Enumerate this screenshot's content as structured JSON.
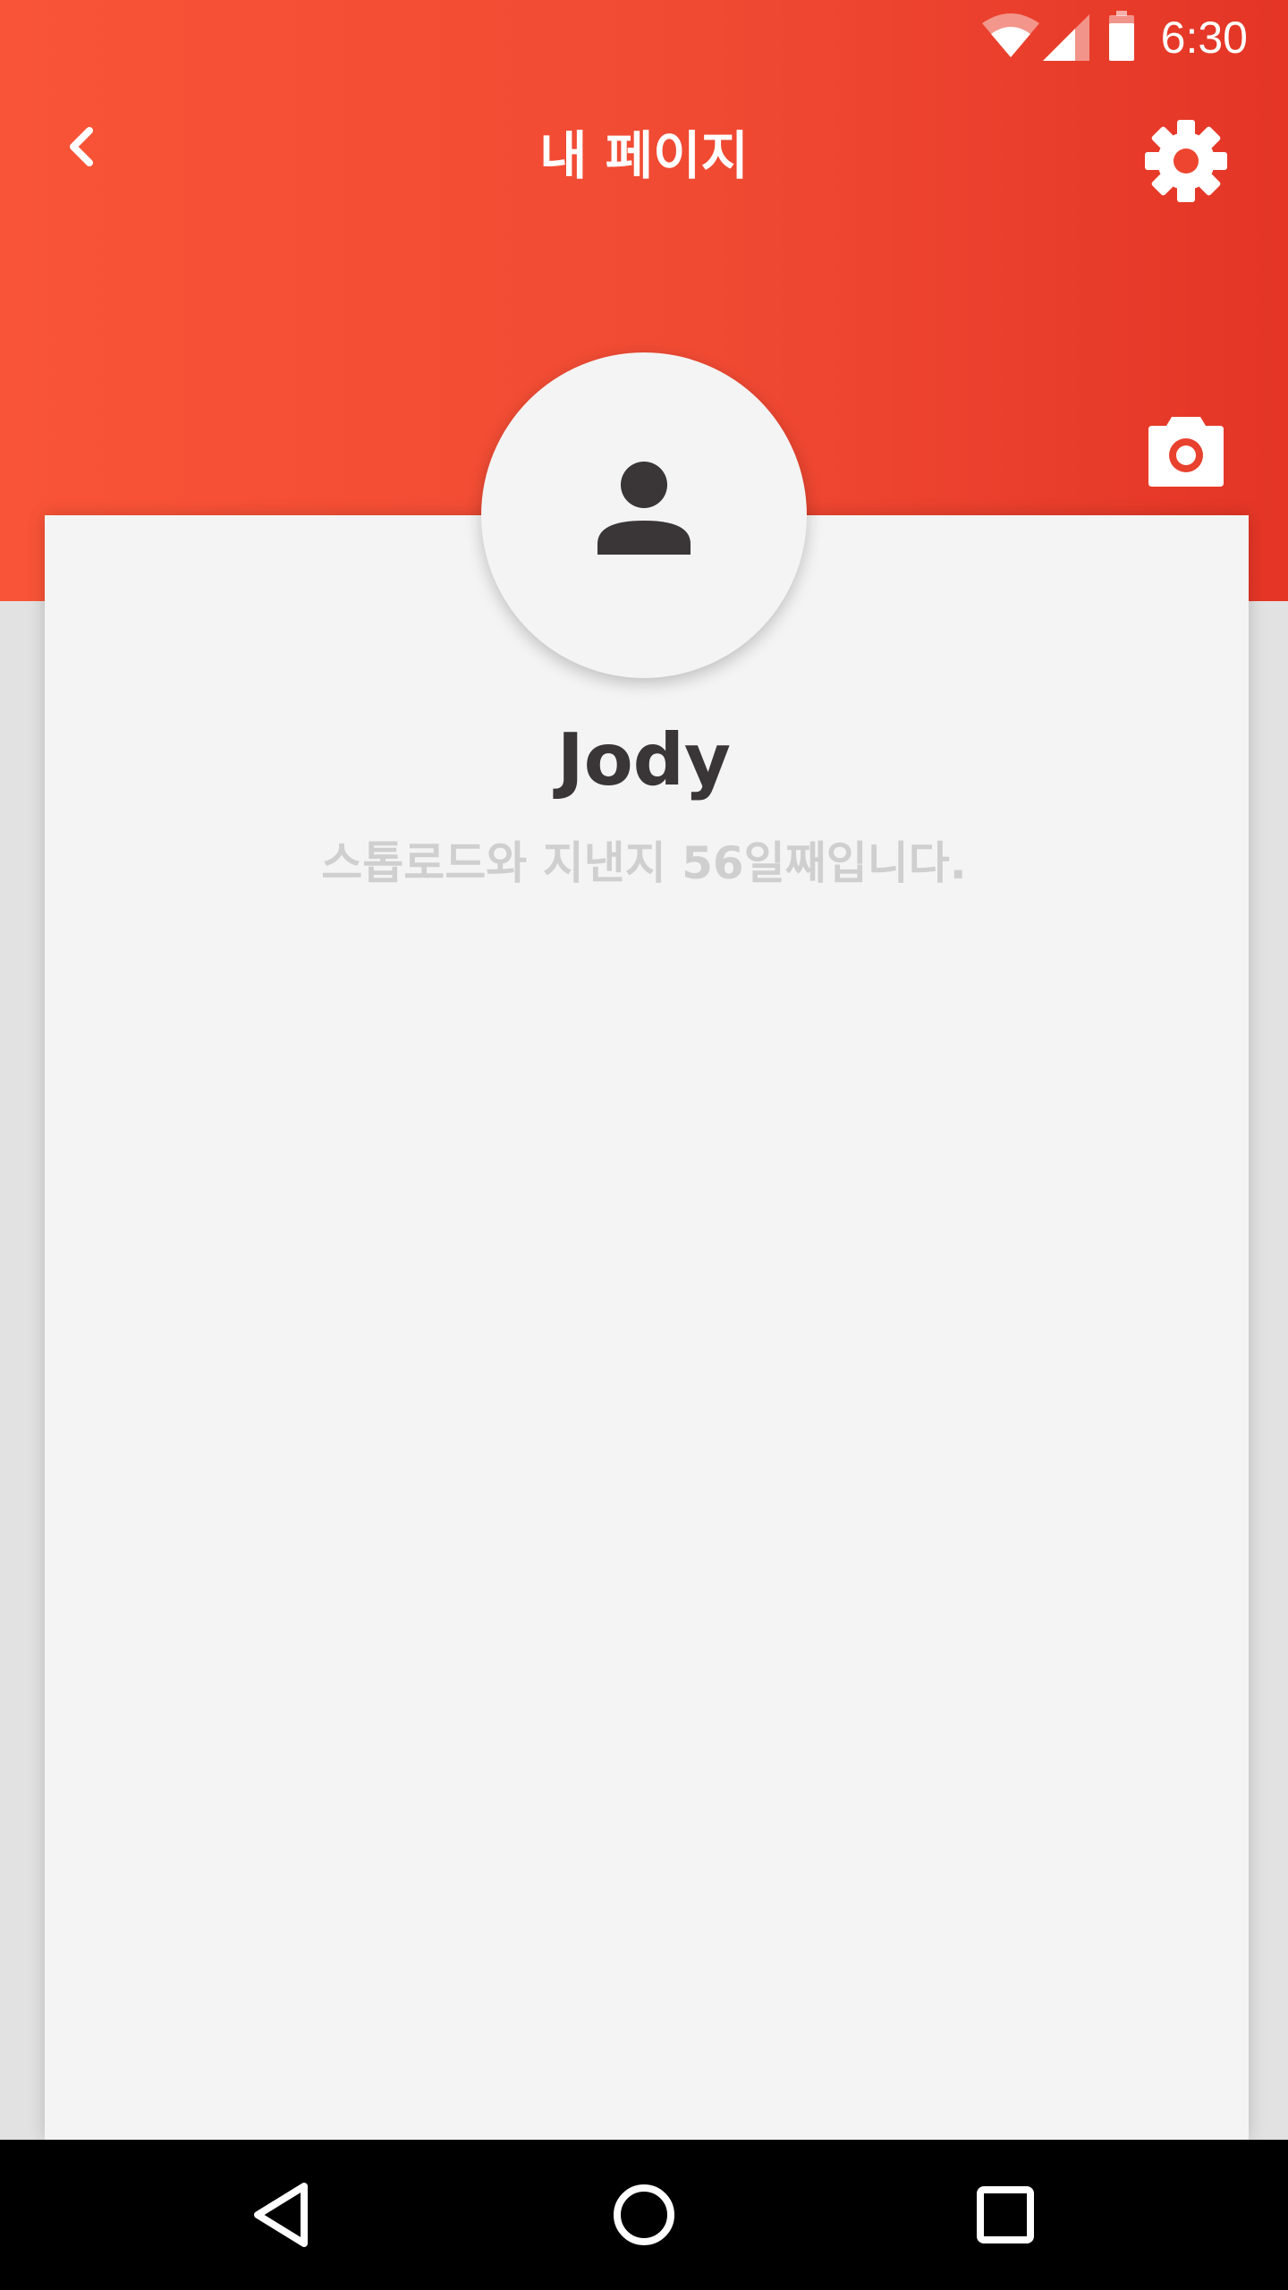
{
  "status_bar": {
    "time": "6:30",
    "icons": [
      "wifi-icon",
      "cell-signal-icon",
      "battery-icon"
    ]
  },
  "toolbar": {
    "title": "내 페이지",
    "back_icon": "chevron-left-icon",
    "settings_icon": "gear-icon"
  },
  "profile": {
    "name": "Jody",
    "subtitle": "스톱로드와 지낸지 56일째입니다.",
    "avatar_icon": "person-icon",
    "camera_icon": "camera-icon"
  },
  "nav_bar": {
    "icons": [
      "back-triangle-icon",
      "home-circle-icon",
      "recents-square-icon"
    ]
  },
  "colors": {
    "header_start": "#f95437",
    "header_end": "#e43526",
    "card_bg": "#f4f4f4",
    "name_text": "#3a3536",
    "subtitle_text": "#cfcfcf"
  }
}
